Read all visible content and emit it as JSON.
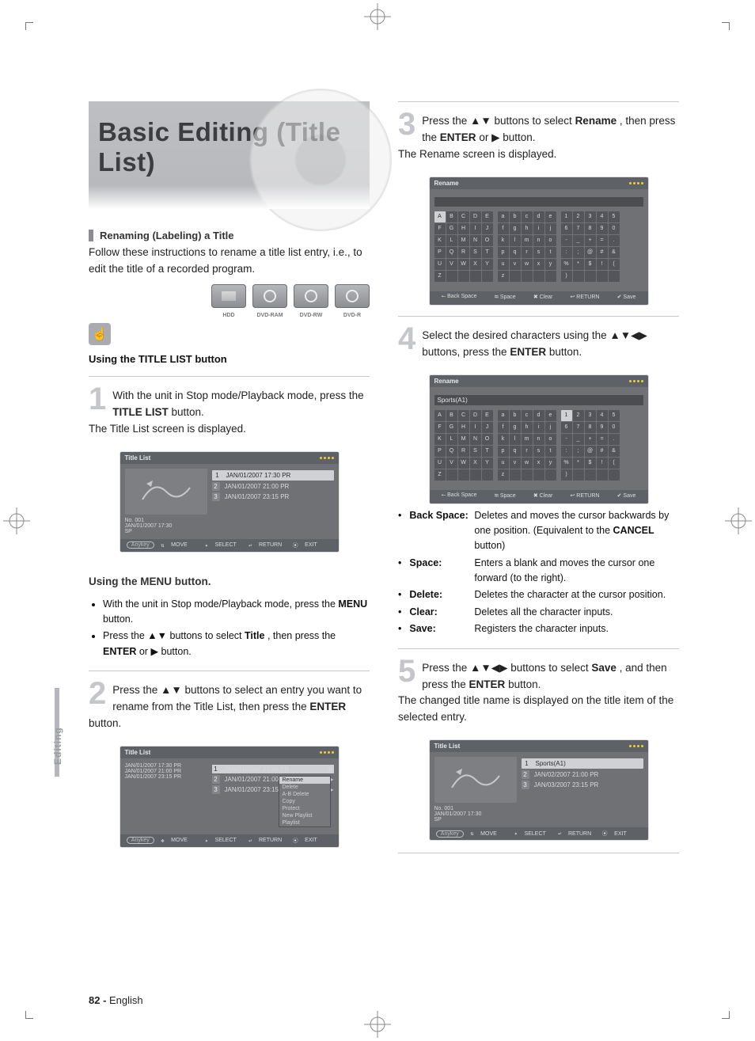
{
  "page": {
    "banner_title": "Basic Editing (Title List)",
    "section1_title": "Renaming (Labeling) a Title",
    "intro": "Follow these instructions to rename a title list entry, i.e., to edit the title of a recorded program.",
    "media": {
      "hdd": "HDD",
      "dvdram": "DVD-RAM",
      "dvdrw": "DVD-RW",
      "dvdr": "DVD-R"
    },
    "using_title": "Using the TITLE LIST button",
    "step1": {
      "num": "1",
      "text_a": "With the unit in Stop mode/Playback mode, press the ",
      "btn": "TITLE LIST",
      "text_b": " button.",
      "text_c": "The Title List screen is displayed."
    },
    "menu_alt": {
      "line1_a": "With the unit in Stop mode/Playback mode, press the ",
      "line1_btn": "MENU",
      "line1_b": " button.",
      "line2_a": "Press the ▲▼ buttons to select ",
      "line2_sel": "Title",
      "line2_b": ", then press the ",
      "line2_btn": "ENTER",
      "line2_c": " or ▶ button."
    },
    "step2": {
      "num": "2",
      "text_a": "Press the ▲▼ buttons to select an entry you want to rename from the Title List, then press the ",
      "btn": "ENTER",
      "text_b": " button."
    },
    "step3": {
      "num": "3",
      "text_a": "Press the ▲▼ buttons to select ",
      "sel": "Rename",
      "text_b": ", then press the ",
      "btn": "ENTER",
      "text_c": " or ▶ button.",
      "text_d": "The Rename screen is displayed."
    },
    "step4": {
      "num": "4",
      "text_a": "Select the desired characters using the ▲▼◀▶ buttons, press the ",
      "btn": "ENTER",
      "text_b": " button."
    },
    "funcs": {
      "backspace": {
        "lbl": "Back Space:",
        "txt_a": " Deletes and moves the cursor backwards by one position. (Equivalent to the ",
        "key": "CANCEL",
        "txt_b": " button)"
      },
      "space": {
        "lbl": "Space:",
        "txt": " Enters a blank and moves the cursor one forward (to the right)."
      },
      "delete": {
        "lbl": "Delete:",
        "txt": " Deletes the character at the cursor position."
      },
      "clear": {
        "lbl": "Clear:",
        "txt": " Deletes all the character inputs."
      },
      "save": {
        "lbl": "Save:",
        "txt": " Registers the character inputs."
      }
    },
    "step5": {
      "num": "5",
      "text_a": "Press the ▲▼◀▶ buttons to select ",
      "sel": "Save",
      "text_b": ", and then press the ",
      "btn": "ENTER",
      "text_c": " button.",
      "text_d": "The changed title name is displayed on the title item of the selected entry."
    },
    "foot_page": "82 - ",
    "foot_lang": "English",
    "side_tab": "Editing"
  },
  "screens": {
    "title_list_label": "Title List",
    "rename_label": "Rename",
    "toolbar": {
      "anykey": "Anykey",
      "move": "MOVE",
      "select": "SELECT",
      "return": "RETURN",
      "exit": "EXIT",
      "backspace": "Back Space",
      "space": "Space",
      "clear": "Clear",
      "save": "Save"
    },
    "dots": "●●●●",
    "title_rows": [
      {
        "idx": "1",
        "txt": "JAN/01/2007  17:30 PR"
      },
      {
        "idx": "2",
        "txt": "JAN/01/2007  21:00 PR"
      },
      {
        "idx": "3",
        "txt": "JAN/01/2007  23:15 PR"
      }
    ],
    "meta_no": "No. 001",
    "meta_date": "JAN/01/2007  17:30",
    "meta_sp": "SP",
    "sidebar_idx": [
      "1",
      "",
      "2",
      "",
      "3"
    ],
    "popup_items": [
      "Rename",
      "Delete",
      "A-B Delete",
      "Copy",
      "Protect",
      "New Playlist",
      "Playlist"
    ],
    "kb_upper": [
      "A",
      "B",
      "C",
      "D",
      "E",
      "F",
      "G",
      "H",
      "I",
      "J",
      "K",
      "L",
      "M",
      "N",
      "O",
      "P",
      "Q",
      "R",
      "S",
      "T",
      "U",
      "V",
      "W",
      "X",
      "Y",
      "Z",
      "",
      "",
      "",
      ""
    ],
    "kb_lower": [
      "a",
      "b",
      "c",
      "d",
      "e",
      "f",
      "g",
      "h",
      "i",
      "j",
      "k",
      "l",
      "m",
      "n",
      "o",
      "p",
      "q",
      "r",
      "s",
      "t",
      "u",
      "v",
      "w",
      "x",
      "y",
      "z",
      "",
      "",
      "",
      ""
    ],
    "kb_sym": [
      "1",
      "2",
      "3",
      "4",
      "5",
      "6",
      "7",
      "8",
      "9",
      "0",
      "-",
      "_",
      "+",
      "=",
      ".",
      ":",
      ";",
      "@",
      "#",
      "&",
      "%",
      "*",
      "$",
      "!",
      "(",
      ")",
      "",
      "",
      "",
      ""
    ],
    "rename_input_blank": "",
    "rename_input_val": "Sports(A1)",
    "final_row0": "Sports(A1)",
    "final_row1": "JAN/02/2007  21:00 PR",
    "final_row2": "JAN/03/2007  23:15 PR"
  }
}
